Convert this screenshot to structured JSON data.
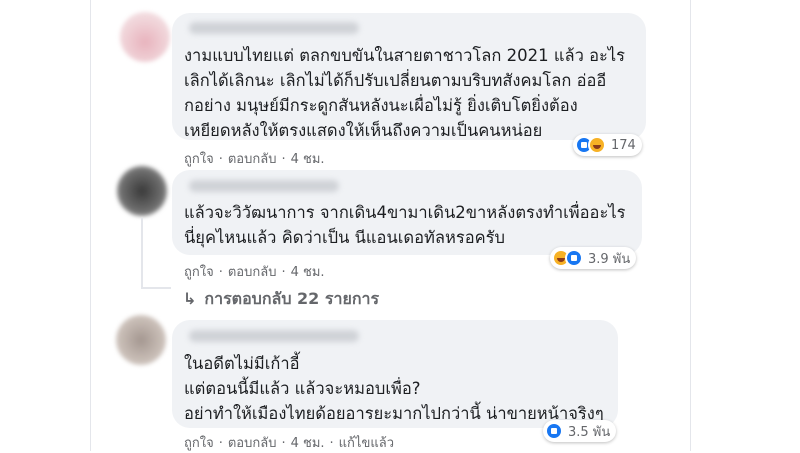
{
  "comments": [
    {
      "lines": [
        "งามแบบไทยแต่ ตลกขบขันในสายตาชาวโลก 2021 แล้ว อะไร",
        "เลิกได้เลิกนะ เลิกไม่ได้ก็ปรับเปลี่ยนตามบริบทสังคมโลก อ่ออี",
        "กอย่าง มนุษย์มีกระดูกสันหลังนะเผื่อไม่รู้ ยิ่งเติบโตยิ่งต้อง",
        "เหยียดหลังให้ตรงแสดงให้เห็นถึงความเป็นคนหน่อย"
      ],
      "like_label": "ถูกใจ",
      "reply_label": "ตอบกลับ",
      "time": "4 ชม.",
      "reaction_icons": [
        "like-icon",
        "haha-icon"
      ],
      "reaction_count": "174"
    },
    {
      "lines": [
        "แล้วจะวิวัฒนาการ จากเดิน4ขามาเดิน2ขาหลังตรงทำเพื่ออะไร",
        "นี่ยุคไหนแล้ว คิดว่าเป็น นีแอนเดอทัลหรอครับ"
      ],
      "like_label": "ถูกใจ",
      "reply_label": "ตอบกลับ",
      "time": "4 ชม.",
      "reaction_icons": [
        "haha-icon",
        "like-icon"
      ],
      "reaction_count": "3.9 พัน",
      "replies_link": "การตอบกลับ 22 รายการ"
    },
    {
      "lines": [
        "ในอดีตไม่มีเก้าอี้",
        "แต่ตอนนี้มีแล้ว แล้วจะหมอบเพื่อ?",
        "อย่าทำให้เมืองไทยด้อยอารยะมากไปกว่านี้ น่าขายหน้าจริงๆ"
      ],
      "like_label": "ถูกใจ",
      "reply_label": "ตอบกลับ",
      "time": "4 ชม.",
      "edited_label": "แก้ไขแล้ว",
      "reaction_icons": [
        "like-icon"
      ],
      "reaction_count": "3.5 พัน"
    }
  ],
  "colors": {
    "bubble": "#f0f2f5",
    "meta_text": "#65676b",
    "like_blue": "#1877f2",
    "haha_yellow": "#f7b125"
  }
}
